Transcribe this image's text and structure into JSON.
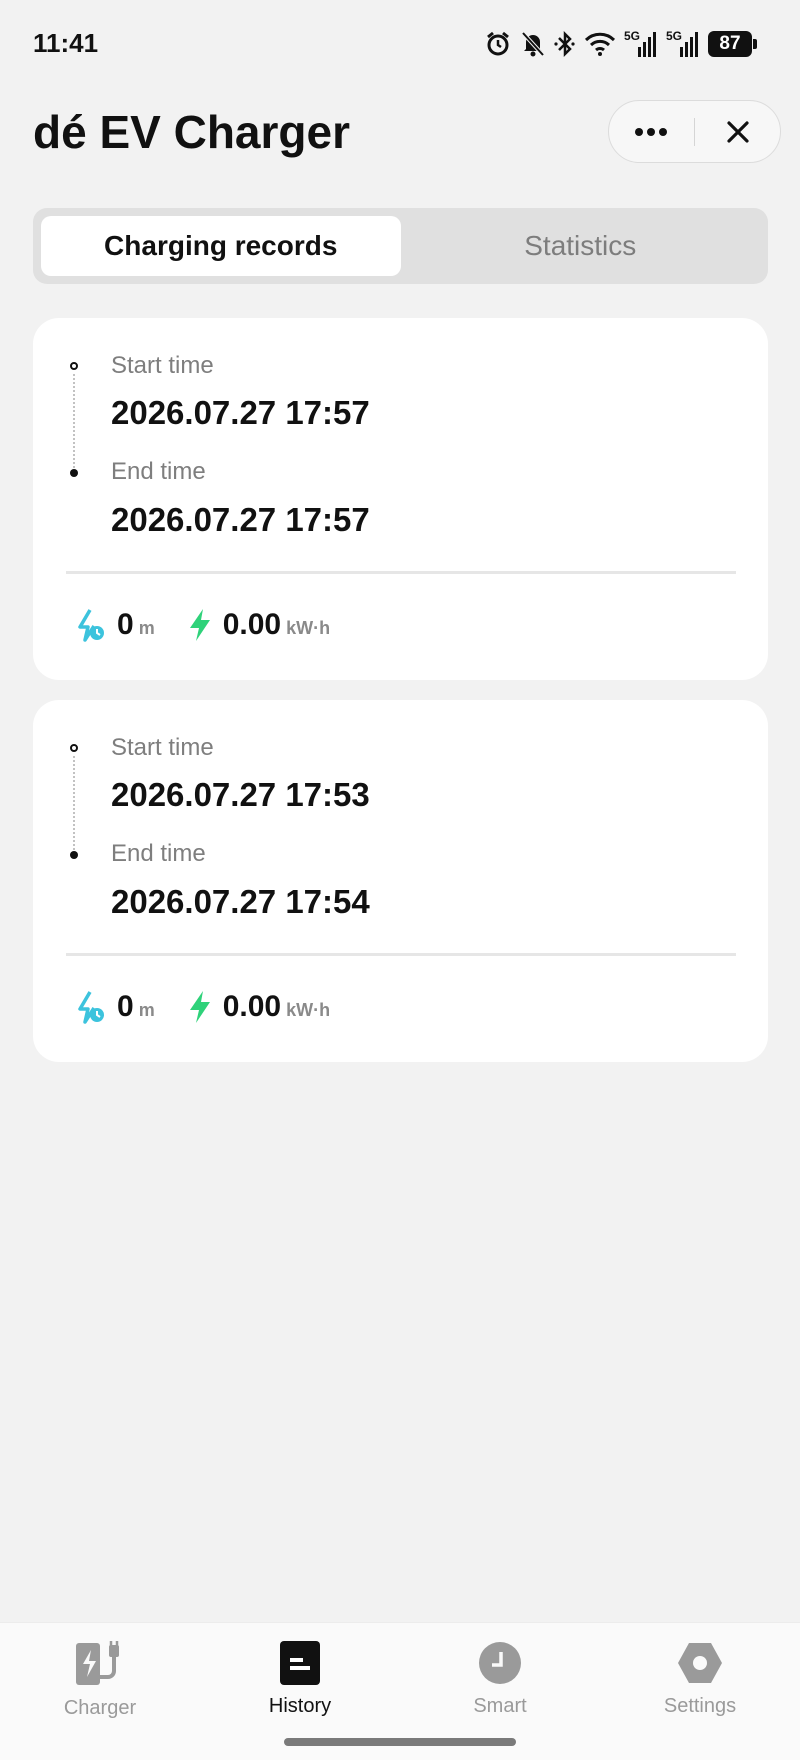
{
  "status": {
    "time": "11:41",
    "net1": "5G",
    "net2": "5G",
    "battery": "87"
  },
  "header": {
    "title": "dé EV Charger"
  },
  "tabs": [
    {
      "label": "Charging records",
      "active": true
    },
    {
      "label": "Statistics",
      "active": false
    }
  ],
  "records": [
    {
      "start_label": "Start time",
      "start_value": "2026.07.27 17:57",
      "end_label": "End time",
      "end_value": "2026.07.27 17:57",
      "duration_value": "0",
      "duration_unit": "m",
      "energy_value": "0.00",
      "energy_unit": "kW·h"
    },
    {
      "start_label": "Start time",
      "start_value": "2026.07.27 17:53",
      "end_label": "End time",
      "end_value": "2026.07.27 17:54",
      "duration_value": "0",
      "duration_unit": "m",
      "energy_value": "0.00",
      "energy_unit": "kW·h"
    }
  ],
  "nav": [
    {
      "label": "Charger",
      "icon": "charger-icon",
      "active": false
    },
    {
      "label": "History",
      "icon": "history-icon",
      "active": true
    },
    {
      "label": "Smart",
      "icon": "clock-icon",
      "active": false
    },
    {
      "label": "Settings",
      "icon": "settings-icon",
      "active": false
    }
  ],
  "colors": {
    "duration_icon": "#3cc3dd",
    "energy_icon": "#2fd27a",
    "nav_inactive": "#9a9a9a",
    "nav_active": "#111111"
  }
}
